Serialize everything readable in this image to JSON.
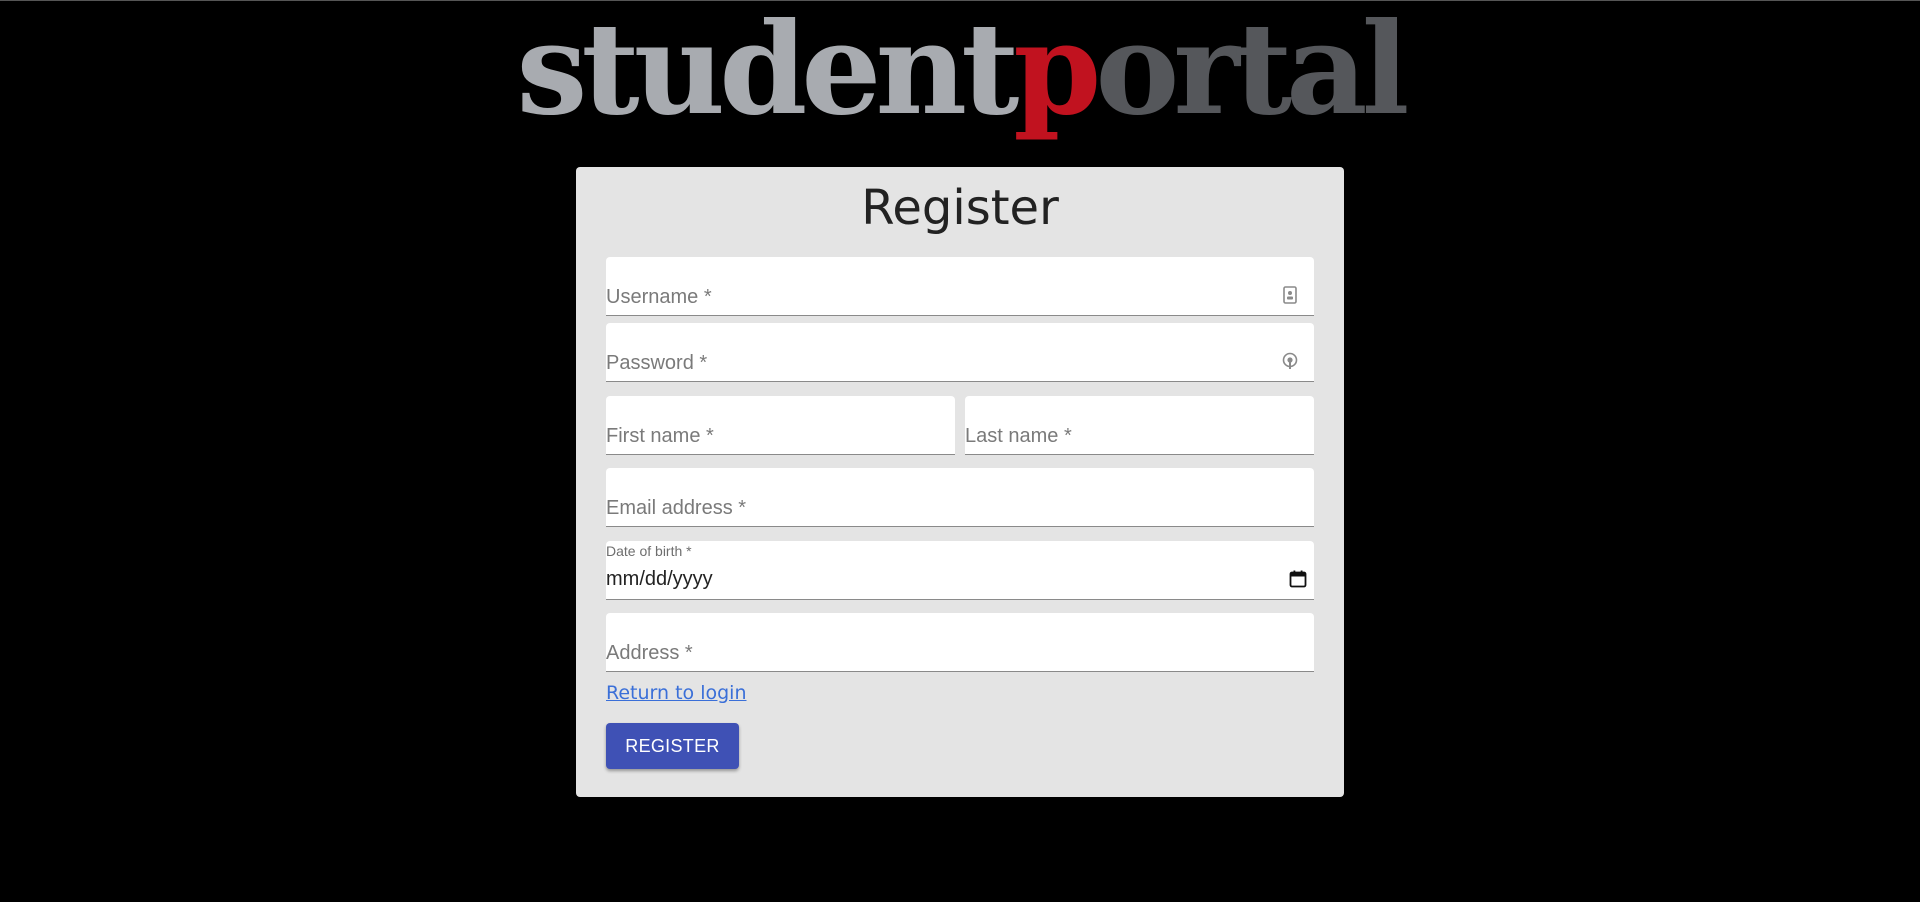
{
  "logo": {
    "part1": "student",
    "part2": "p",
    "part3": "ortal"
  },
  "form": {
    "title": "Register",
    "username_label": "Username *",
    "password_label": "Password *",
    "first_name_label": "First name *",
    "last_name_label": "Last name *",
    "email_label": "Email address *",
    "dob_label": "Date of birth *",
    "dob_value": "mm/dd/yyyy",
    "address_label": "Address *",
    "return_link": "Return to login",
    "register_button": "REGISTER"
  },
  "icons": {
    "username": "contact-card-icon",
    "password": "key-icon",
    "date": "calendar-icon"
  },
  "colors": {
    "background": "#000000",
    "card": "#e4e4e4",
    "logo_light": "#a8abb0",
    "logo_accent": "#c1121f",
    "logo_dark": "#55575b",
    "button": "#3f51b5",
    "link": "#3a6fd8"
  }
}
